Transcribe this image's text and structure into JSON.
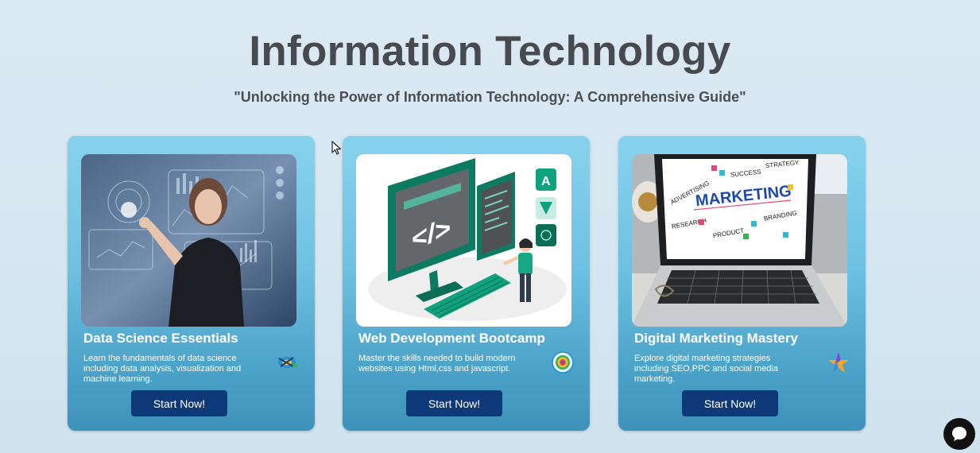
{
  "header": {
    "title": "Information Technology",
    "subtitle": "\"Unlocking the Power of Information Technology: A Comprehensive Guide\""
  },
  "cards": [
    {
      "title": "Data Science Essentials",
      "description": "Learn the fundamentals of data science including data analysis, visualization and machine learning.",
      "button_label": "Start Now!",
      "image_icon": "data-science-hologram-image",
      "badge_icon": "tech-logo-icon"
    },
    {
      "title": "Web Development Bootcamp",
      "description": "Master the skills needed to build modern websites using Html,css and javascript.",
      "button_label": "Start Now!",
      "image_icon": "web-development-illustration",
      "badge_icon": "target-icon",
      "image_code_symbol": "</>"
    },
    {
      "title": "Digital Marketing Mastery",
      "description": "Explore digital marketing strategies including SEO,PPC and social media marketing.",
      "button_label": "Start Now!",
      "image_icon": "marketing-laptop-image",
      "badge_icon": "star-logo-icon",
      "image_words": {
        "main": "MARKETING",
        "strategy": "STRATEGY",
        "success": "SUCCESS",
        "advertising": "ADVERTISING",
        "research": "RESEARCH",
        "product": "PRODUCT",
        "branding": "BRANDING"
      }
    }
  ],
  "colors": {
    "background": "#d6e7f1",
    "title": "#474a4e",
    "card_top": "#86d3ee",
    "card_bottom": "#3f92ba",
    "button": "#0d3979",
    "chat_button": "#111111"
  },
  "widgets": {
    "chat_icon": "chat-bubble-icon",
    "cursor_icon": "mouse-pointer-icon"
  }
}
